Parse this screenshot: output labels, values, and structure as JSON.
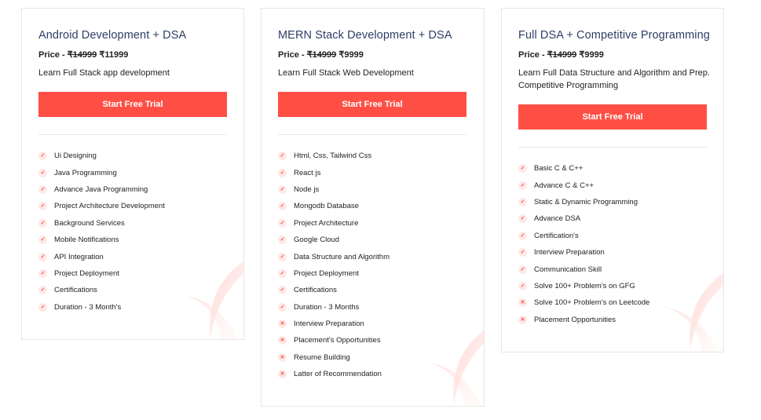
{
  "cards": [
    {
      "title": "Android Development + DSA",
      "price_label": "Price - ",
      "old_price": "₹14999",
      "new_price": "₹11999",
      "description": "Learn Full Stack app development",
      "button": "Start Free Trial",
      "features": [
        {
          "text": "Ui Designing",
          "included": true
        },
        {
          "text": "Java Programming",
          "included": true
        },
        {
          "text": "Advance Java Programming",
          "included": true
        },
        {
          "text": "Project Architecture Development",
          "included": true
        },
        {
          "text": "Background Services",
          "included": true
        },
        {
          "text": "Mobile Notifications",
          "included": true
        },
        {
          "text": "API Integration",
          "included": true
        },
        {
          "text": "Project Deployment",
          "included": true
        },
        {
          "text": "Certifications",
          "included": true
        },
        {
          "text": "Duration - 3 Month's",
          "included": true
        }
      ]
    },
    {
      "title": "MERN Stack Development + DSA",
      "price_label": "Price - ",
      "old_price": "₹14999",
      "new_price": "₹9999",
      "description": "Learn Full Stack Web Development",
      "button": "Start Free Trial",
      "features": [
        {
          "text": "Html, Css, Tailwind Css",
          "included": true
        },
        {
          "text": "React js",
          "included": true
        },
        {
          "text": "Node js",
          "included": true
        },
        {
          "text": "Mongodb Database",
          "included": true
        },
        {
          "text": "Project Architecture",
          "included": true
        },
        {
          "text": "Google Cloud",
          "included": true
        },
        {
          "text": "Data Structure and Algorithm",
          "included": true
        },
        {
          "text": "Project Deployment",
          "included": true
        },
        {
          "text": "Certifications",
          "included": true
        },
        {
          "text": "Duration - 3 Months",
          "included": true
        },
        {
          "text": "Interview Preparation",
          "included": false
        },
        {
          "text": "Placement's Opportunities",
          "included": false
        },
        {
          "text": "Resume Building",
          "included": false
        },
        {
          "text": "Latter of Recommendation",
          "included": false
        }
      ]
    },
    {
      "title": "Full DSA + Competitive Programming",
      "price_label": "Price - ",
      "old_price": "₹14999",
      "new_price": "₹9999",
      "description": "Learn Full Data Structure and Algorithm and Prep. Competitive Programming",
      "button": "Start Free Trial",
      "features": [
        {
          "text": "Basic C & C++",
          "included": true
        },
        {
          "text": "Advance C & C++",
          "included": true
        },
        {
          "text": "Static & Dynamic Programming",
          "included": true
        },
        {
          "text": "Advance DSA",
          "included": true
        },
        {
          "text": "Certification's",
          "included": true
        },
        {
          "text": "Interview Preparation",
          "included": true
        },
        {
          "text": "Communication Skill",
          "included": true
        },
        {
          "text": "Solve 100+ Problem's on GFG",
          "included": true
        },
        {
          "text": "Solve 100+ Problem's on Leetcode",
          "included": false
        },
        {
          "text": "Placement Opportunities",
          "included": false
        }
      ]
    }
  ],
  "icons": {
    "included": "check-icon",
    "excluded": "cross-icon"
  },
  "colors": {
    "accent": "#ff4f44",
    "title": "#2c3e66",
    "badge_bg": "#fde9e7"
  }
}
